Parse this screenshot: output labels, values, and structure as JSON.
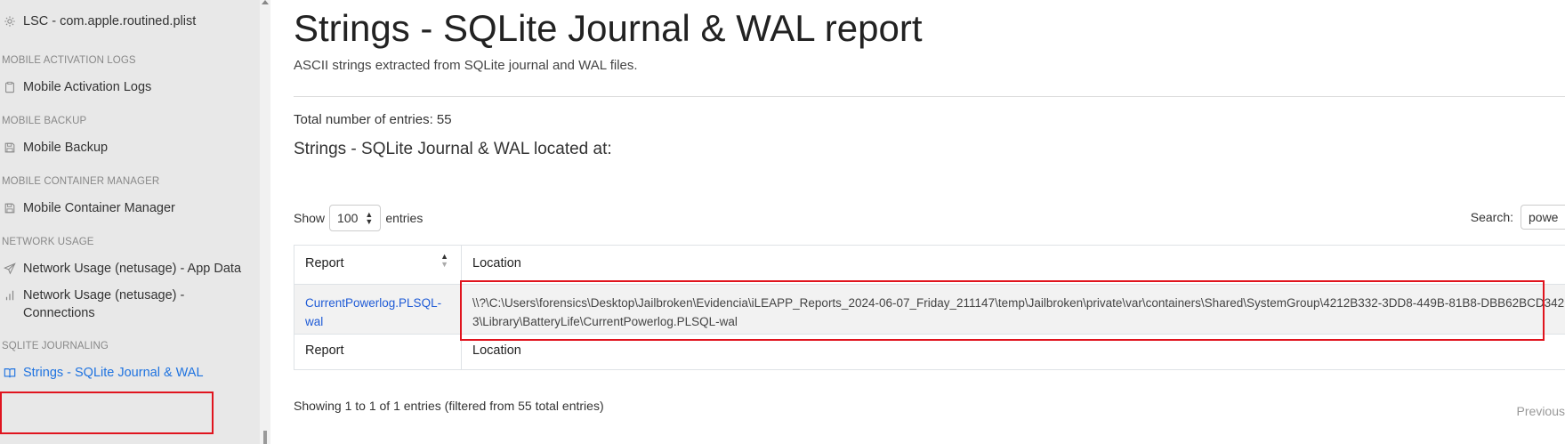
{
  "sidebar": {
    "items": [
      {
        "type": "item",
        "label": "LSC - com.apple.routined.plist",
        "icon": "gear-icon"
      },
      {
        "type": "header",
        "label": "MOBILE ACTIVATION LOGS"
      },
      {
        "type": "item",
        "label": "Mobile Activation Logs",
        "icon": "clipboard-icon"
      },
      {
        "type": "header",
        "label": "MOBILE BACKUP"
      },
      {
        "type": "item",
        "label": "Mobile Backup",
        "icon": "save-icon"
      },
      {
        "type": "header",
        "label": "MOBILE CONTAINER MANAGER"
      },
      {
        "type": "item",
        "label": "Mobile Container Manager",
        "icon": "save-icon"
      },
      {
        "type": "header",
        "label": "NETWORK USAGE"
      },
      {
        "type": "item",
        "label": "Network Usage (netusage) - App Data",
        "icon": "send-icon"
      },
      {
        "type": "item",
        "label": "Network Usage (netusage) - Connections",
        "icon": "bar-chart-icon"
      },
      {
        "type": "header",
        "label": "SQLITE JOURNALING"
      },
      {
        "type": "item",
        "label": "Strings - SQLite Journal & WAL",
        "icon": "book-open-icon",
        "active": true
      }
    ]
  },
  "main": {
    "title": "Strings - SQLite Journal & WAL report",
    "description": "ASCII strings extracted from SQLite journal and WAL files.",
    "total_entries": "Total number of entries: 55",
    "located_at": "Strings - SQLite Journal & WAL located at:",
    "show_label": "Show",
    "show_value": "100",
    "entries_label": "entries",
    "search_label": "Search:",
    "search_value": "power",
    "table": {
      "columns": [
        "Report",
        "Location"
      ],
      "rows": [
        {
          "report": "CurrentPowerlog.PLSQL-wal",
          "location": "\\\\?\\C:\\Users\\forensics\\Desktop\\Jailbroken\\Evidencia\\iLEAPP_Reports_2024-06-07_Friday_211147\\temp\\Jailbroken\\private\\var\\containers\\Shared\\SystemGroup\\4212B332-3DD8-449B-81B8-DBB62BCD3423\\Library\\BatteryLife\\CurrentPowerlog.PLSQL-wal"
        }
      ],
      "footer": [
        "Report",
        "Location"
      ]
    },
    "showing_info": "Showing 1 to 1 of 1 entries (filtered from 55 total entries)",
    "prev_label": "Previous"
  },
  "colors": {
    "accent": "#1f73e0",
    "highlight": "#e0141e",
    "sidebar_bg": "#e8e8e8"
  }
}
